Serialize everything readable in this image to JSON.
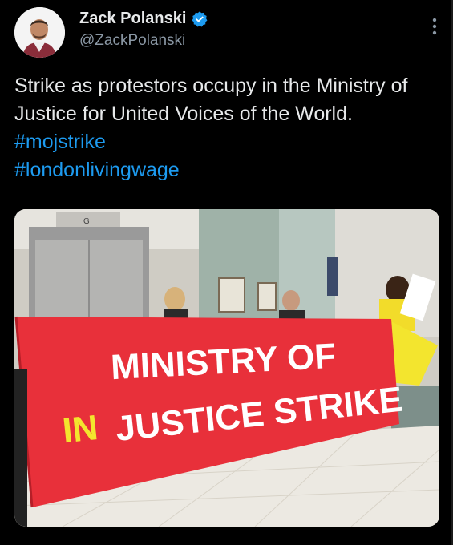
{
  "author": {
    "display_name": "Zack Polanski",
    "handle": "@ZackPolanski",
    "verified": true,
    "avatar_icon": "profile-photo"
  },
  "tweet": {
    "text_parts": [
      "Strike as protestors occupy in the Ministry of Justice for United Voices of the World. "
    ],
    "hashtags": [
      "#mojstrike",
      "#londonlivingwage"
    ]
  },
  "media": {
    "banner_line1": "MINISTRY OF",
    "banner_line2_yellow": "IN",
    "banner_line2_rest": "JUSTICE STRIKE",
    "lift_sign": "G"
  },
  "colors": {
    "background": "#000000",
    "text": "#e7e9ea",
    "secondary": "#8b98a5",
    "link": "#1d9bf0",
    "verified_badge": "#1d9bf0",
    "banner_red": "#e8303a",
    "banner_yellow": "#f3e52e"
  },
  "icons": {
    "verified": "verified-badge-icon",
    "more": "more-options-icon"
  }
}
